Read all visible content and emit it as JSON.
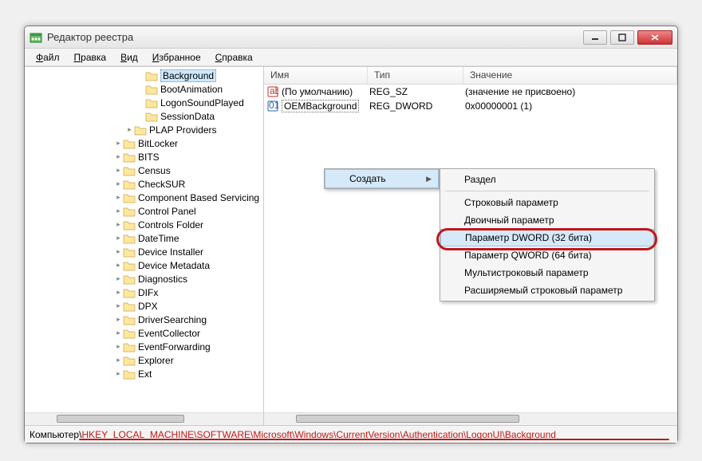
{
  "window": {
    "title": "Редактор реестра"
  },
  "menubar": [
    "Файл",
    "Правка",
    "Вид",
    "Избранное",
    "Справка"
  ],
  "tree": {
    "items_closed": [
      "BitLocker",
      "BITS",
      "Census",
      "CheckSUR",
      "Component Based Servicing",
      "Control Panel",
      "Controls Folder",
      "DateTime",
      "Device Installer",
      "Device Metadata",
      "Diagnostics",
      "DIFx",
      "DPX",
      "DriverSearching",
      "EventCollector",
      "EventForwarding",
      "Explorer",
      "Ext"
    ],
    "logonui_children": [
      "Background",
      "BootAnimation",
      "LogonSoundPlayed",
      "SessionData"
    ],
    "plap": "PLAP Providers"
  },
  "list": {
    "headers": {
      "name": "Имя",
      "type": "Тип",
      "value": "Значение"
    },
    "rows": [
      {
        "name": "(По умолчанию)",
        "type": "REG_SZ",
        "value": "(значение не присвоено)",
        "kind": "sz"
      },
      {
        "name": "OEMBackground",
        "type": "REG_DWORD",
        "value": "0x00000001 (1)",
        "kind": "dw",
        "sel": true
      }
    ]
  },
  "ctx_parent": {
    "label": "Создать"
  },
  "ctx_sub": {
    "section": "Раздел",
    "items": [
      "Строковый параметр",
      "Двоичный параметр",
      "Параметр DWORD (32 бита)",
      "Параметр QWORD (64 бита)",
      "Мультистроковый параметр",
      "Расширяемый строковый параметр"
    ]
  },
  "statusbar": {
    "prefix": "Компьютер\\",
    "path": "HKEY_LOCAL_MACHINE\\SOFTWARE\\Microsoft\\Windows\\CurrentVersion\\Authentication\\LogonUI\\Background"
  }
}
